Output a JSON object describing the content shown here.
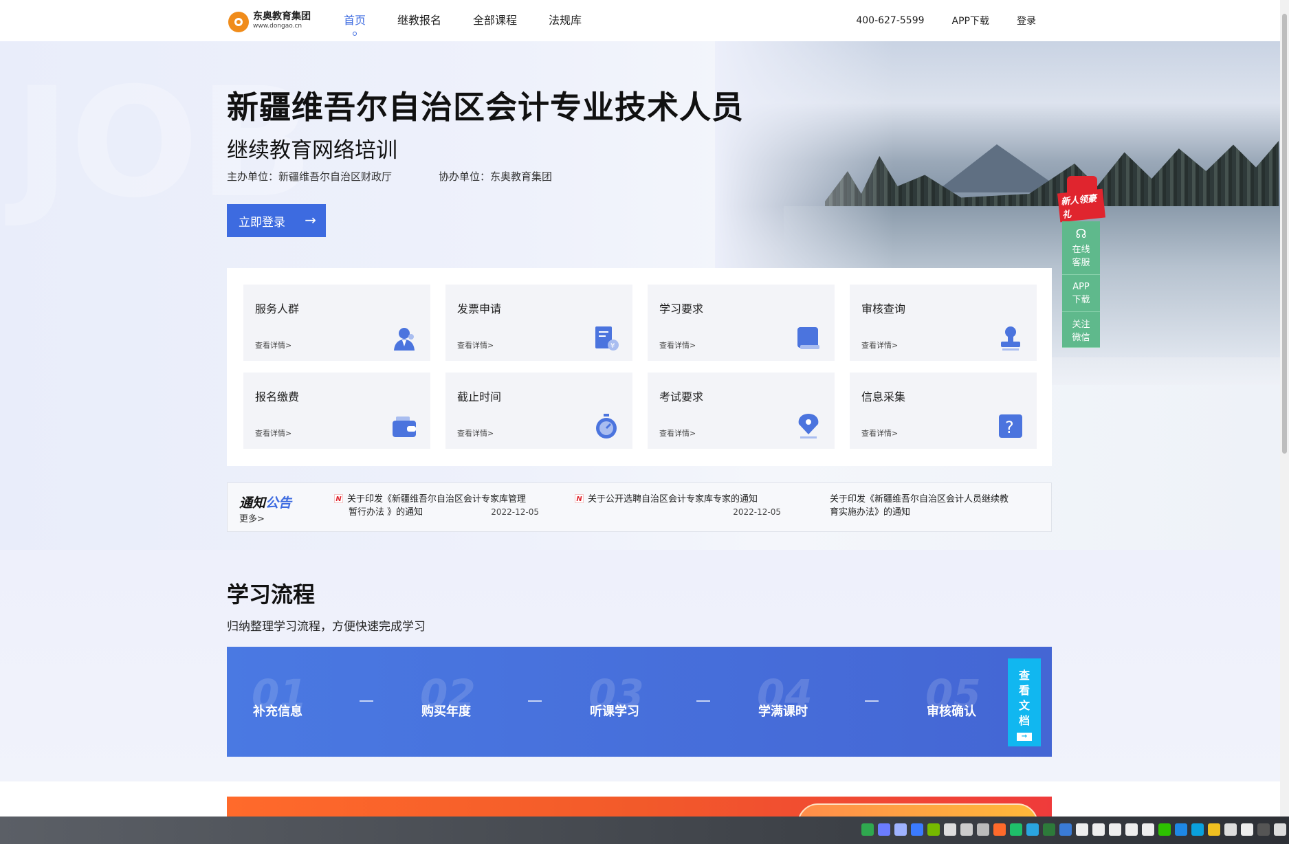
{
  "header": {
    "logo_cn": "东奥教育集团",
    "logo_url": "www.dongao.cn",
    "nav": [
      {
        "label": "首页",
        "active": true
      },
      {
        "label": "继教报名",
        "active": false
      },
      {
        "label": "全部课程",
        "active": false
      },
      {
        "label": "法规库",
        "active": false
      }
    ],
    "phone": "400-627-5599",
    "app_download": "APP下载",
    "login": "登录"
  },
  "hero": {
    "title": "新疆维吾尔自治区会计专业技术人员",
    "subtitle": "继续教育网络培训",
    "host": "主办单位：新疆维吾尔自治区财政厅",
    "co_host": "协办单位：东奥教育集团",
    "login_button": "立即登录",
    "login_arrow": "→"
  },
  "side": {
    "gift": "新人领豪礼",
    "online_service": [
      "在线",
      "客服"
    ],
    "app": [
      "APP",
      "下载"
    ],
    "wechat": [
      "关注",
      "微信"
    ]
  },
  "services": [
    {
      "title": "服务人群",
      "more": "查看详情>",
      "icon": "user-badge-icon"
    },
    {
      "title": "发票申请",
      "more": "查看详情>",
      "icon": "invoice-icon"
    },
    {
      "title": "学习要求",
      "more": "查看详情>",
      "icon": "book-icon"
    },
    {
      "title": "审核查询",
      "more": "查看详情>",
      "icon": "stamp-icon"
    },
    {
      "title": "报名缴费",
      "more": "查看详情>",
      "icon": "wallet-icon"
    },
    {
      "title": "截止时间",
      "more": "查看详情>",
      "icon": "stopwatch-icon"
    },
    {
      "title": "考试要求",
      "more": "查看详情>",
      "icon": "pen-nib-icon"
    },
    {
      "title": "信息采集",
      "more": "查看详情>",
      "icon": "question-icon"
    }
  ],
  "notice": {
    "title_a": "通知",
    "title_b": "公告",
    "more": "更多>",
    "items": [
      {
        "badge": "N",
        "line1": "关于印发《新疆维吾尔自治区会计专家库管理",
        "line2": "暂行办法 》的通知",
        "date": "2022-12-05"
      },
      {
        "badge": "N",
        "line1": "关于公开选聘自治区会计专家库专家的通知",
        "line2": "",
        "date": "2022-12-05"
      },
      {
        "badge": "",
        "line1": "关于印发《新疆维吾尔自治区会计人员继续教",
        "line2": "育实施办法》的通知",
        "date": ""
      }
    ]
  },
  "process": {
    "title": "学习流程",
    "subtitle": "归纳整理学习流程，方便快速完成学习",
    "steps": [
      {
        "num": "01",
        "label": "补充信息"
      },
      {
        "num": "02",
        "label": "购买年度"
      },
      {
        "num": "03",
        "label": "听课学习"
      },
      {
        "num": "04",
        "label": "学满课时"
      },
      {
        "num": "05",
        "label": "审核确认"
      }
    ],
    "doc_button": [
      "查",
      "看",
      "文",
      "档"
    ],
    "doc_arrow": "→"
  },
  "colors": {
    "accent": "#3d6be0",
    "side_green": "#5fb98c",
    "doc_cyan": "#11b7f0",
    "banner_orange": "#ff6a2b"
  }
}
